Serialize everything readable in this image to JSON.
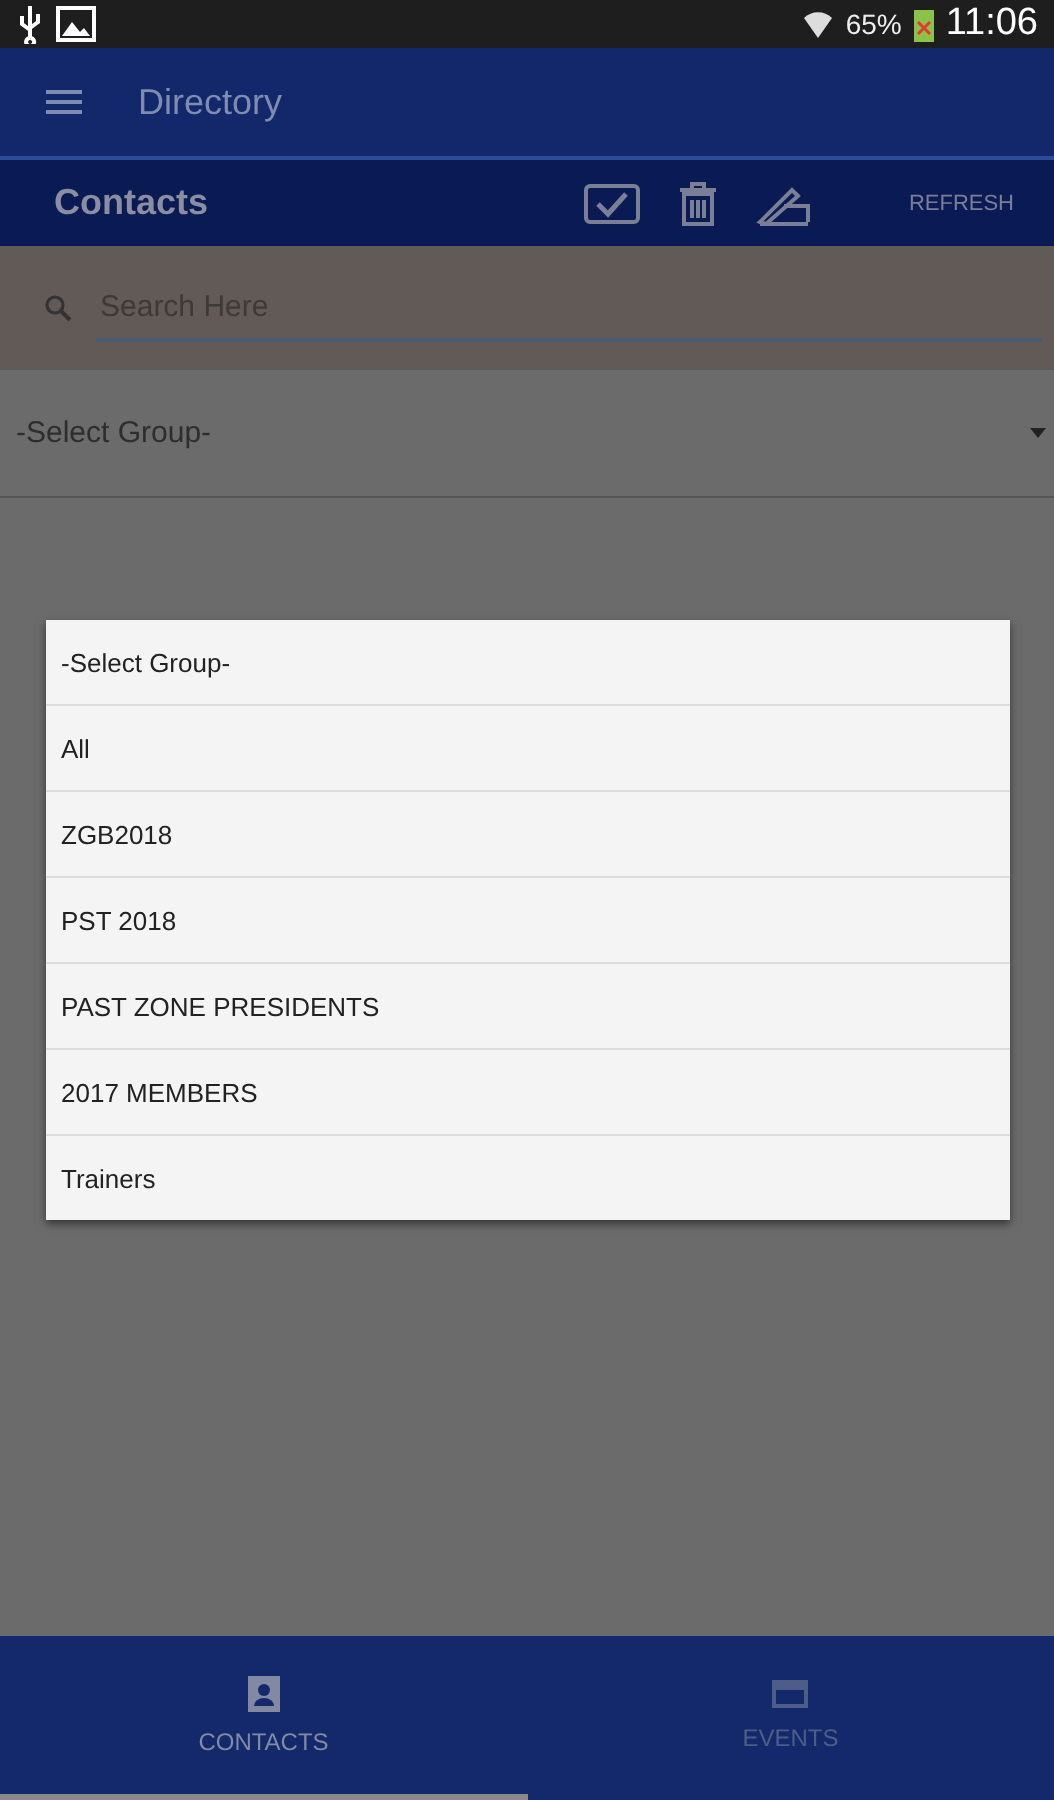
{
  "status_bar": {
    "battery": "65%",
    "time": "11:06"
  },
  "app_bar": {
    "title": "Directory"
  },
  "toolbar": {
    "title": "Contacts",
    "action": "REFRESH"
  },
  "search": {
    "placeholder": "Search Here"
  },
  "group_select": {
    "value": "-Select Group-"
  },
  "dialog": {
    "options": [
      "-Select Group-",
      "All",
      "ZGB2018",
      "PST 2018",
      "PAST ZONE PRESIDENTS",
      "2017 MEMBERS",
      "Trainers"
    ]
  },
  "bottom_nav": [
    {
      "label": "CONTACTS",
      "kind": "contacts",
      "selected": true
    },
    {
      "label": "EVENTS",
      "kind": "events",
      "selected": false
    }
  ]
}
